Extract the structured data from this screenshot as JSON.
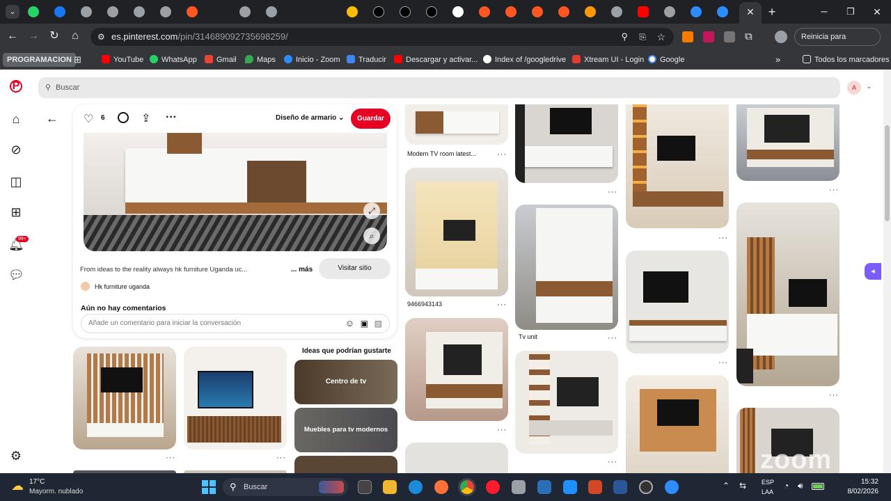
{
  "browser": {
    "url_host": "es.pinterest.com",
    "url_path": "/pin/314689092735698259/",
    "update_label": "Reinicia para actualizar",
    "bookmarks": [
      {
        "label": "PROGRAMACION",
        "color": "#5f6368"
      },
      {
        "label": "YouTube",
        "color": "#ff0000"
      },
      {
        "label": "WhatsApp",
        "color": "#25d366"
      },
      {
        "label": "Gmail",
        "color": "#ea4335"
      },
      {
        "label": "Maps",
        "color": "#34a853"
      },
      {
        "label": "Inicio - Zoom",
        "color": "#2d8cff"
      },
      {
        "label": "Traducir",
        "color": "#4285f4"
      },
      {
        "label": "Descargar y activar...",
        "color": "#ff0000"
      },
      {
        "label": "Index of /googledrive",
        "color": "#ffffff"
      },
      {
        "label": "Xtream UI - Login",
        "color": "#e53935"
      },
      {
        "label": "Google",
        "color": "#ffffff"
      }
    ],
    "all_bookmarks_label": "Todos los marcadores"
  },
  "pinterest": {
    "search_placeholder": "Buscar",
    "avatar_letter": "A",
    "notification_badge": "99+",
    "pin": {
      "likes": "6",
      "board": "Diseño de armario",
      "save_label": "Guardar",
      "description": "From ideas to the reality always hk furniture Uganda uc...",
      "more_label": "... más",
      "visit_label": "Visitar sitio",
      "author": "Hk furniture uganda",
      "comments_title": "Aún no hay comentarios",
      "comment_placeholder": "Añade un comentario para iniciar la conversación"
    },
    "ideas_title": "Ideas que podrían gustarte",
    "ideas": [
      {
        "label": "Centro de tv"
      },
      {
        "label": "Muebles para tv modernos"
      }
    ],
    "captions": {
      "c1": "Modern TV room latest...",
      "c2": "9466943143",
      "c3": "Tv unit"
    }
  },
  "taskbar": {
    "temp": "17°C",
    "weather": "Mayorm. nublado",
    "search_label": "Buscar",
    "lang1": "ESP",
    "lang2": "LAA",
    "time": "15:32",
    "date": "8/02/2026"
  }
}
